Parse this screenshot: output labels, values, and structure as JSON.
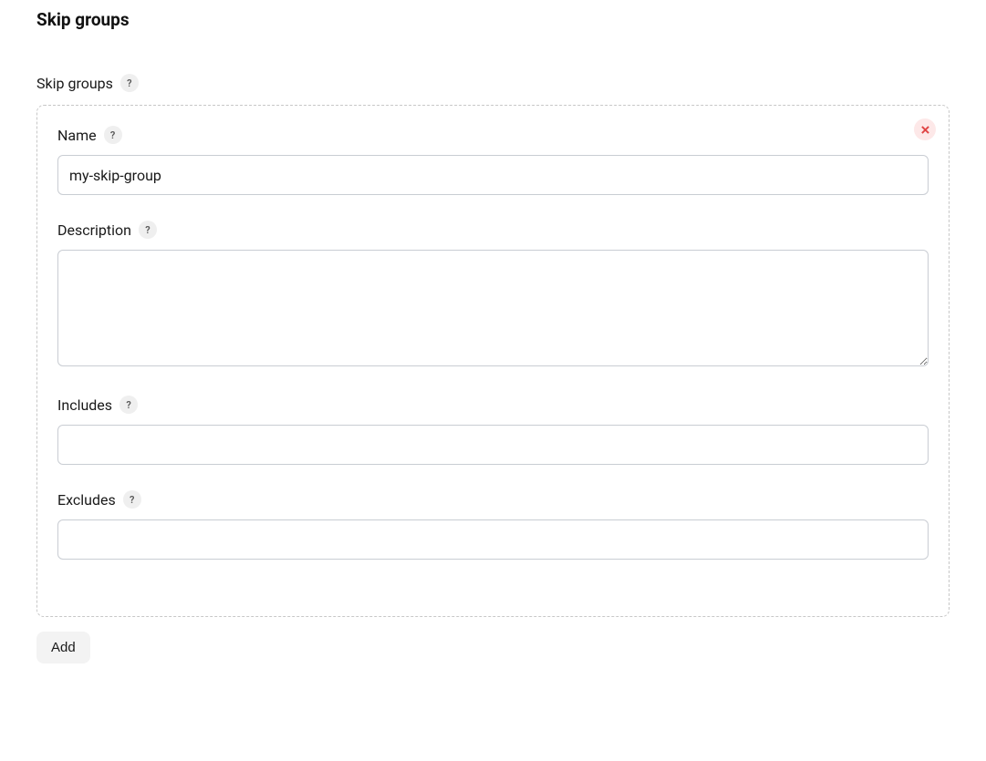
{
  "section": {
    "title": "Skip groups",
    "label": "Skip groups"
  },
  "group": {
    "name": {
      "label": "Name",
      "value": "my-skip-group"
    },
    "description": {
      "label": "Description",
      "value": ""
    },
    "includes": {
      "label": "Includes",
      "value": ""
    },
    "excludes": {
      "label": "Excludes",
      "value": ""
    }
  },
  "buttons": {
    "add": "Add"
  },
  "help_glyph": "?"
}
